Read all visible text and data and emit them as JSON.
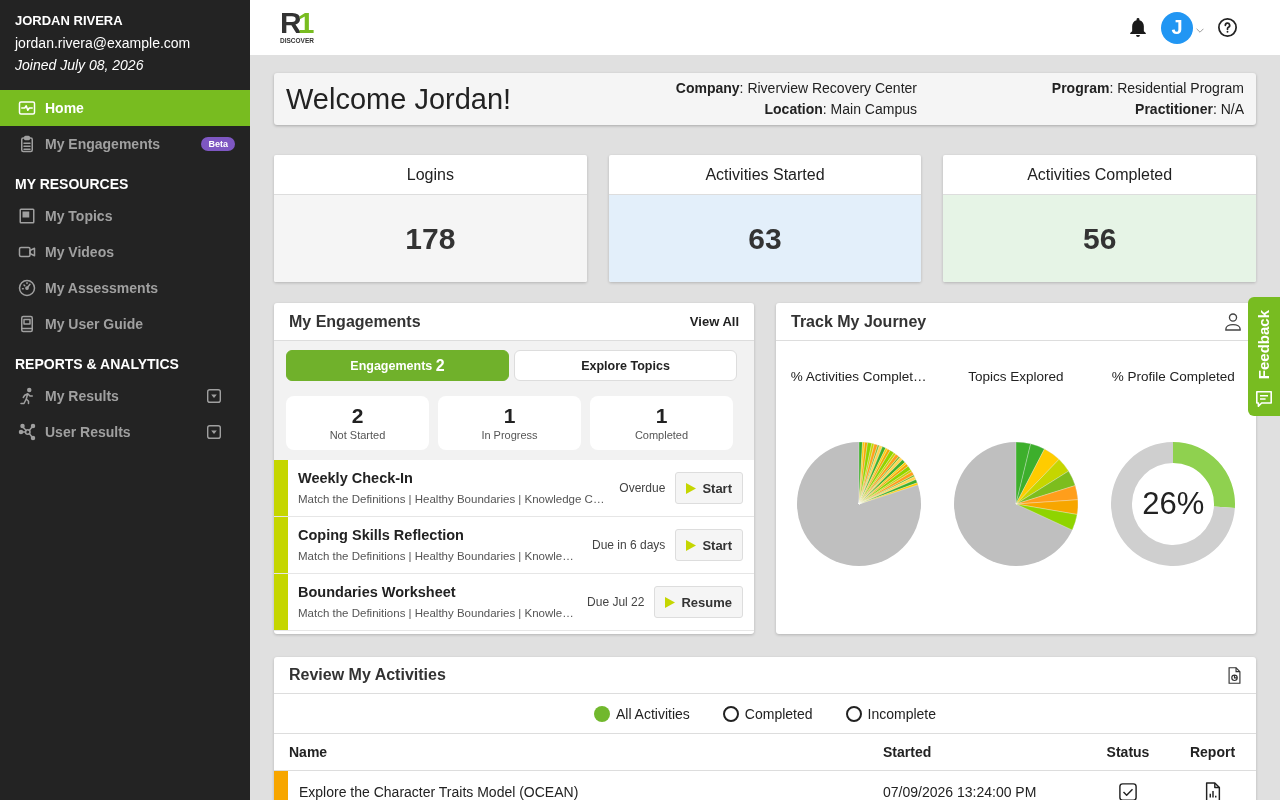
{
  "sidebar": {
    "user": {
      "name": "JORDAN RIVERA",
      "email": "jordan.rivera@example.com",
      "joined": "Joined July 08, 2026"
    },
    "sections": [
      {
        "items": [
          {
            "label": "Home",
            "selected": true,
            "menu": false
          },
          {
            "label": "My Engagements",
            "badge": "Beta",
            "selected": false,
            "menu": false
          }
        ]
      },
      {
        "heading": "MY RESOURCES",
        "items": [
          {
            "label": "My Topics",
            "selected": false,
            "menu": false
          },
          {
            "label": "My Videos",
            "selected": false,
            "menu": false
          },
          {
            "label": "My Assessments",
            "selected": false,
            "menu": false
          },
          {
            "label": "My User Guide",
            "selected": false,
            "menu": false
          }
        ]
      },
      {
        "heading": "REPORTS & ANALYTICS",
        "items": [
          {
            "label": "My Results",
            "selected": false,
            "menu": true
          },
          {
            "label": "User Results",
            "selected": false,
            "menu": true
          }
        ]
      }
    ]
  },
  "topbar": {
    "logo": {
      "letters": "R",
      "numeral": "1",
      "tagline": "DISCOVER"
    },
    "avatar": {
      "initial": "J"
    }
  },
  "welcome": {
    "title": "Welcome Jordan!",
    "columns": [
      {
        "lines": [
          "**Company**: Riverview Recovery Center",
          "**Location**: Main Campus"
        ]
      },
      {
        "lines": [
          "**Program**: Residential Program",
          "**Practitioner**: N/A"
        ]
      }
    ]
  },
  "stats": [
    {
      "label": "Logins",
      "value": "178",
      "color": "#f5f5f5"
    },
    {
      "label": "Activities Started",
      "value": "63",
      "color": "#e3effa"
    },
    {
      "label": "Activities Completed",
      "value": "56",
      "color": "#e6f4e6"
    }
  ],
  "engagements": {
    "title": "My Engagements",
    "link": "View All",
    "tabs": [
      {
        "label": "Engagements",
        "count": "2",
        "selected": true
      },
      {
        "label": "Explore Topics",
        "selected": false
      }
    ],
    "counts": [
      {
        "value": "2",
        "label": "Not Started"
      },
      {
        "value": "1",
        "label": "In Progress"
      },
      {
        "value": "1",
        "label": "Completed"
      }
    ],
    "items": [
      {
        "title": "Weekly Check-In",
        "details": "Match the Definitions | Healthy Boundaries | Knowledge C…",
        "due": "Overdue",
        "action": "Start"
      },
      {
        "title": "Coping Skills Reflection",
        "details": "Match the Definitions | Healthy Boundaries | Knowle…",
        "due": "Due in 6 days",
        "action": "Start"
      },
      {
        "title": "Boundaries Worksheet",
        "details": "Match the Definitions | Healthy Boundaries | Knowle…",
        "due": "Due Jul 22",
        "action": "Resume"
      }
    ]
  },
  "journey": {
    "title": "Track My Journey",
    "charts": [
      {
        "kind": "pie",
        "title": "% Activities Complet…"
      },
      {
        "kind": "pie",
        "title": "Topics Explored"
      },
      {
        "kind": "ring",
        "title": "% Profile Completed",
        "reading": "26%",
        "chart_data": {
          "type": "donut",
          "values": [
            26,
            74
          ]
        }
      }
    ]
  },
  "feedback": {
    "label": "Feedback"
  },
  "activities": {
    "title": "Review My Activities",
    "filters": [
      {
        "label": "All Activities",
        "selected": true
      },
      {
        "label": "Completed",
        "selected": false
      },
      {
        "label": "Incomplete",
        "selected": false
      }
    ],
    "columns": [
      "Name",
      "Started",
      "Status",
      "Report"
    ],
    "rows": [
      {
        "name": "Explore the Character Traits Model (OCEAN)",
        "started": "07/09/2026 13:24:00 PM",
        "color": "#f7a600",
        "done": true
      }
    ]
  }
}
